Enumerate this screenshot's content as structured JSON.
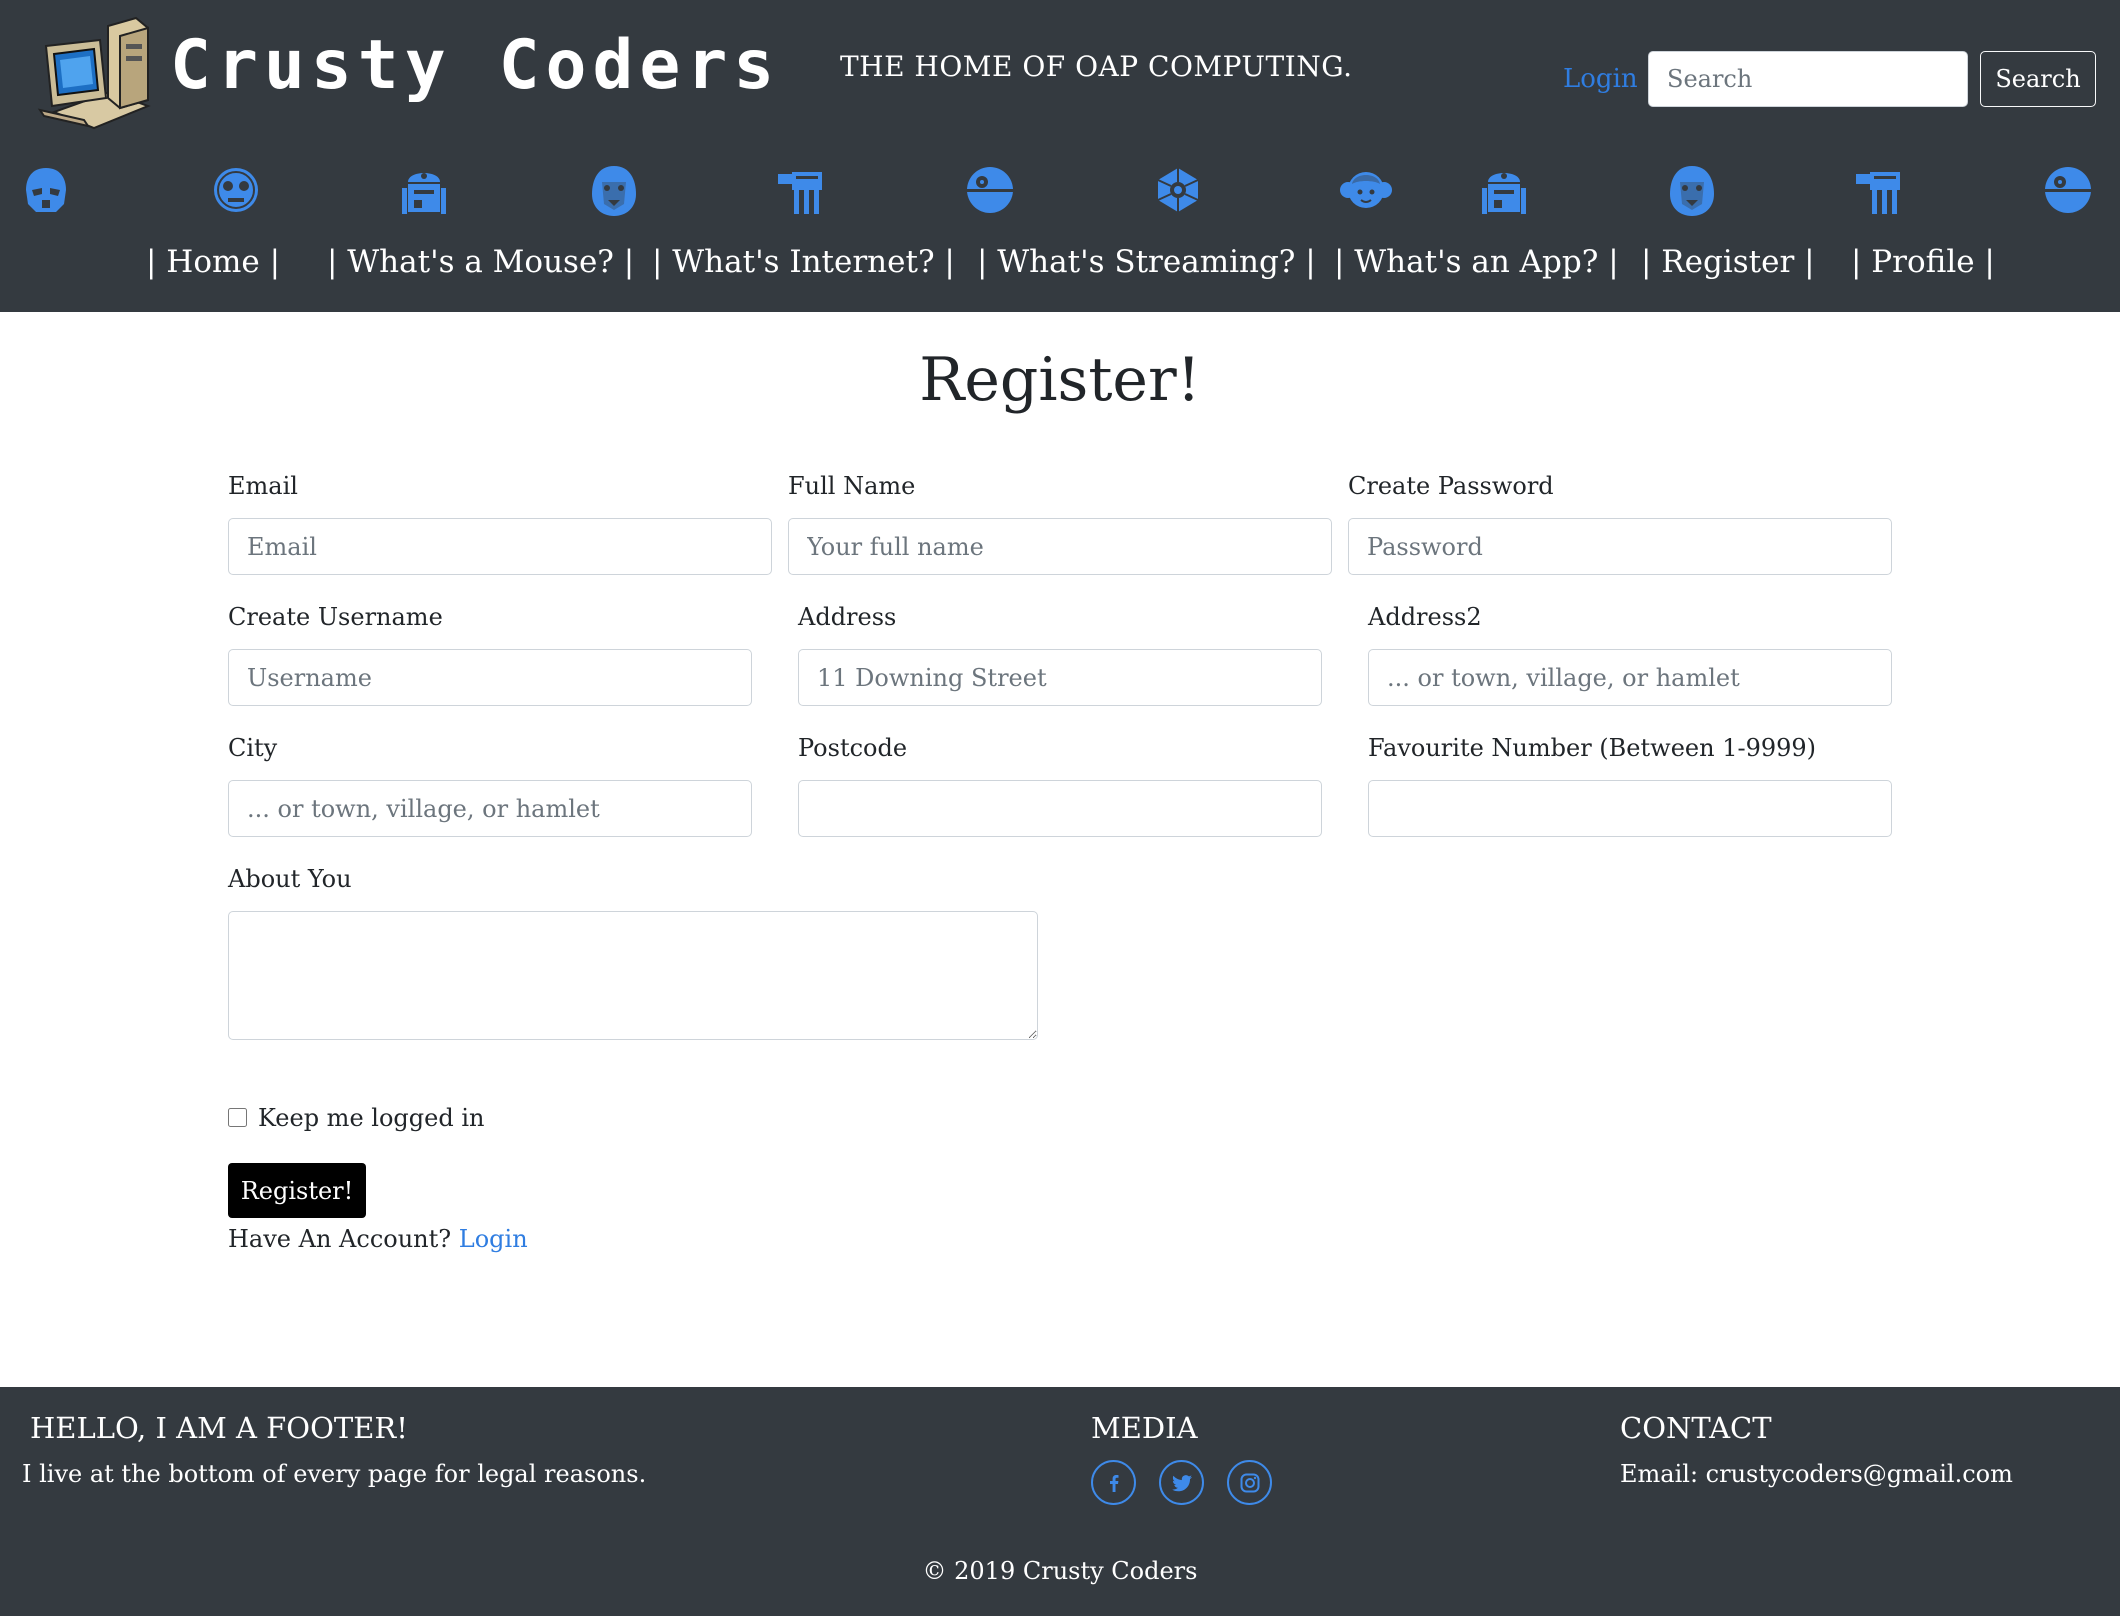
{
  "header": {
    "brand": "Crusty Coders",
    "tagline": "THE HOME OF OAP COMPUTING.",
    "login_label": "Login",
    "search_placeholder": "Search",
    "search_button": "Search",
    "icons": [
      "stormtrooper-icon",
      "c3po-icon",
      "r2d2-icon",
      "chewbacca-icon",
      "at-at-icon",
      "death-star-icon",
      "tie-fighter-icon",
      "leia-icon",
      "r2d2-icon",
      "chewbacca-icon",
      "at-at-icon",
      "death-star-icon"
    ],
    "accent_color": "#3e8ae9"
  },
  "nav": {
    "items": [
      "| Home |",
      "| What's a Mouse? |",
      "| What's Internet? |",
      "| What's Streaming? |",
      "| What's an App? |",
      "| Register |",
      "| Profile |"
    ]
  },
  "form": {
    "title": "Register!",
    "fields": {
      "email": {
        "label": "Email",
        "placeholder": "Email",
        "value": ""
      },
      "full_name": {
        "label": "Full Name",
        "placeholder": "Your full name",
        "value": ""
      },
      "password": {
        "label": "Create Password",
        "placeholder": "Password",
        "value": ""
      },
      "username": {
        "label": "Create Username",
        "placeholder": "Username",
        "value": ""
      },
      "address": {
        "label": "Address",
        "placeholder": "11 Downing Street",
        "value": ""
      },
      "address2": {
        "label": "Address2",
        "placeholder": "... or town, village, or hamlet",
        "value": ""
      },
      "city": {
        "label": "City",
        "placeholder": "... or town, village, or hamlet",
        "value": ""
      },
      "postcode": {
        "label": "Postcode",
        "placeholder": "",
        "value": ""
      },
      "favourite_number": {
        "label": "Favourite Number (Between 1-9999)",
        "placeholder": "",
        "value": ""
      },
      "about": {
        "label": "About You",
        "value": ""
      }
    },
    "keep_logged_in": {
      "label": "Keep me logged in",
      "checked": false
    },
    "submit_label": "Register!",
    "have_account_text": "Have An Account?",
    "login_link": "Login"
  },
  "footer": {
    "heading": "HELLO, I AM A FOOTER!",
    "text": "I live at the bottom of every page for legal reasons.",
    "media_heading": "MEDIA",
    "social_icons": [
      "facebook-icon",
      "twitter-icon",
      "instagram-icon"
    ],
    "contact_heading": "CONTACT",
    "contact_email": "Email: crustycoders@gmail.com",
    "copyright": "© 2019 Crusty Coders"
  }
}
